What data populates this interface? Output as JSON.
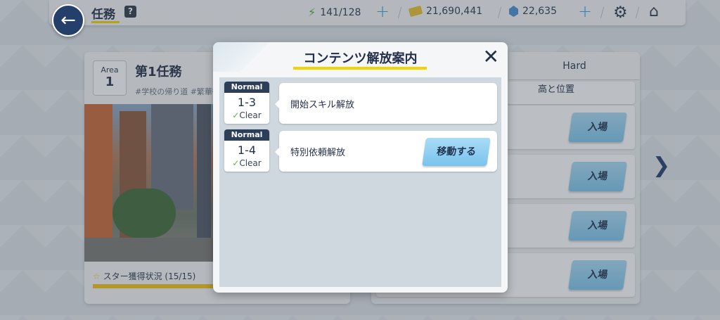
{
  "header": {
    "title": "任務",
    "help_label": "?",
    "stamina": "141/128",
    "credits": "21,690,441",
    "gems": "22,635",
    "plus_label": "+"
  },
  "icons": {
    "back": "arrow-left-icon",
    "stamina": "lightning-icon",
    "credits": "ticket-icon",
    "gems": "gem-icon",
    "settings": "gear-icon",
    "home": "home-icon",
    "close": "close-icon",
    "next": "chevron-right-icon",
    "check": "check-icon",
    "star": "star-icon"
  },
  "area": {
    "label": "Area",
    "number": "1",
    "name": "第1任務",
    "tags": "#学校の帰り道 #繁華街",
    "star_status": "スター獲得状況 (15/15)"
  },
  "stages": {
    "hard_tab": "Hard",
    "row0_partial": "高と位置",
    "enter_label": "入場",
    "next_arrow": "❯"
  },
  "modal": {
    "title": "コンテンツ解放案内",
    "close": "✕",
    "rows": [
      {
        "difficulty": "Normal",
        "stage": "1-3",
        "clear": "Clear",
        "text": "開始スキル解放"
      },
      {
        "difficulty": "Normal",
        "stage": "1-4",
        "clear": "Clear",
        "text": "特別依頼解放",
        "button": "移動する"
      }
    ]
  },
  "colors": {
    "accent_yellow": "#f5d300",
    "navy": "#24406a",
    "button_blue": "#7dc6ee",
    "check_green": "#5bb246"
  }
}
